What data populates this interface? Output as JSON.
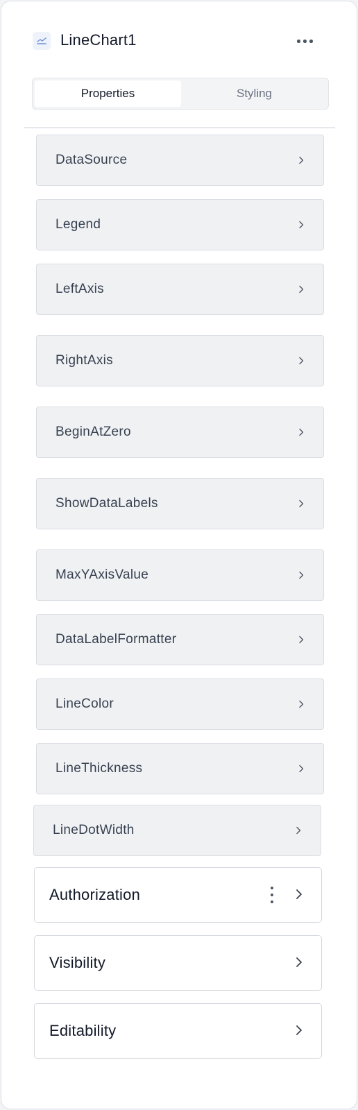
{
  "header": {
    "title": "LineChart1",
    "icon": "line-chart-icon",
    "menu_icon": "more-horizontal-icon"
  },
  "tabs": [
    {
      "label": "Properties",
      "active": true
    },
    {
      "label": "Styling",
      "active": false
    }
  ],
  "properties": [
    {
      "label": "DataSource",
      "icon": "chevron-right-icon"
    },
    {
      "label": "Legend",
      "icon": "chevron-right-icon"
    },
    {
      "label": "LeftAxis",
      "icon": "chevron-right-icon"
    },
    {
      "label": "RightAxis",
      "icon": "chevron-right-icon"
    },
    {
      "label": "BeginAtZero",
      "icon": "chevron-right-icon"
    },
    {
      "label": "ShowDataLabels",
      "icon": "chevron-right-icon"
    },
    {
      "label": "MaxYAxisValue",
      "icon": "chevron-right-icon"
    },
    {
      "label": "DataLabelFormatter",
      "icon": "chevron-right-icon"
    },
    {
      "label": "LineColor",
      "icon": "chevron-right-icon"
    },
    {
      "label": "LineThickness",
      "icon": "chevron-right-icon"
    },
    {
      "label": "LineDotWidth",
      "icon": "chevron-right-icon"
    }
  ],
  "sections": [
    {
      "label": "Authorization",
      "has_menu": true
    },
    {
      "label": "Visibility",
      "has_menu": false
    },
    {
      "label": "Editability",
      "has_menu": false
    }
  ],
  "colors": {
    "panel_background": "#ffffff",
    "property_background": "#f0f1f3",
    "text_primary": "#111827",
    "text_property": "#374151",
    "text_muted": "#6b7280",
    "icon_accent": "#6b8fd6"
  }
}
